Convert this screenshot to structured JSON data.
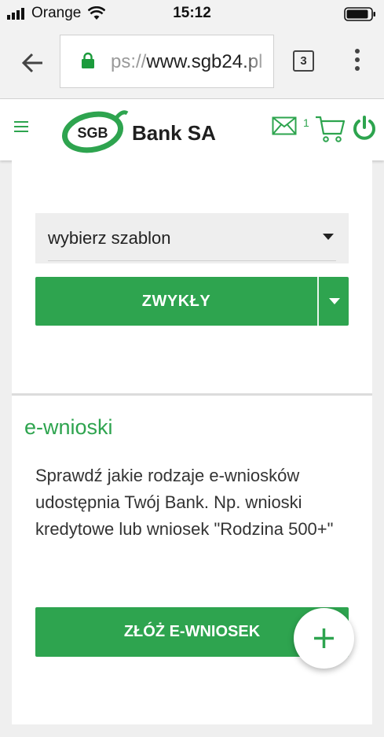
{
  "status_bar": {
    "carrier": "Orange",
    "time": "15:12"
  },
  "browser": {
    "url_faded": "ps://",
    "url_main": "www.sgb24.pl",
    "tab_count": "3"
  },
  "site_header": {
    "logo_mark": "SGB",
    "logo_text": "Bank SA",
    "mail_count": "1"
  },
  "transfer_card": {
    "template_select_value": "wybierz szablon",
    "transfer_type_label": "ZWYKŁY"
  },
  "ewnioski_card": {
    "title": "e-wnioski",
    "description": "Sprawdź jakie rodzaje e-wniosków udostępnia Twój Bank. Np. wnioski kredytowe lub wniosek \"Rodzina 500+\"",
    "button_label": "ZŁÓŻ E-WNIOSEK"
  },
  "colors": {
    "brand_green": "#2ea44f",
    "icon_green": "#2da44e"
  },
  "icons": [
    "signal-icon",
    "wifi-icon",
    "battery-icon",
    "back-arrow-icon",
    "lock-icon",
    "menu-dots-icon",
    "hamburger-icon",
    "mail-icon",
    "cart-icon",
    "power-icon",
    "chevron-down-icon",
    "plus-icon"
  ]
}
